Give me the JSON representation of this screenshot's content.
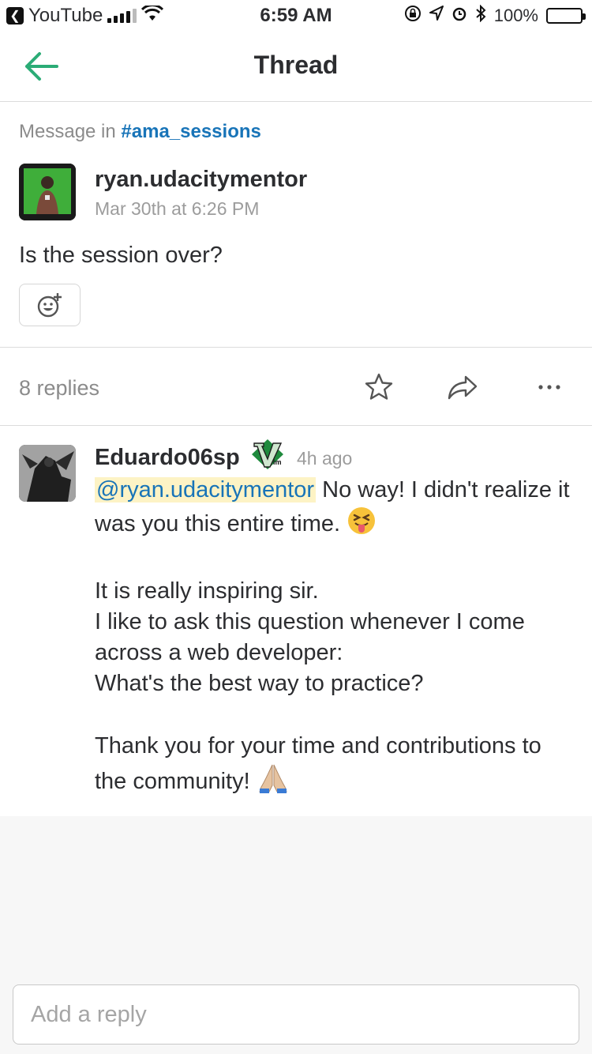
{
  "status_bar": {
    "back_app": "YouTube",
    "time": "6:59 AM",
    "battery": "100%"
  },
  "header": {
    "title": "Thread",
    "back_icon": "arrow-left-icon"
  },
  "parent_message": {
    "context_prefix": "Message in",
    "channel": "#ama_sessions",
    "username": "ryan.udacitymentor",
    "timestamp": "Mar 30th at 6:26 PM",
    "text": "Is the session over?",
    "reaction_icon": "add-reaction-icon"
  },
  "thread_actions": {
    "reply_count": "8 replies",
    "icons": [
      "star-icon",
      "share-icon",
      "more-icon"
    ]
  },
  "reply": {
    "username": "Eduardo06sp",
    "badge_icon": "vim-badge-icon",
    "timestamp": "4h ago",
    "mention": "@ryan.udacitymentor",
    "line1_rest": " No way! I didn't realize it was you this entire time. ",
    "line2": "It is really inspiring sir.",
    "line3": "I like to ask this question whenever I come across a web developer:",
    "line4": "What's the best way to practice?",
    "line5": "Thank you for your time and contributions to the community! ",
    "emoji_1": "tongue-emoji",
    "emoji_2": "praying-hands-emoji"
  },
  "composer": {
    "placeholder": "Add a reply"
  },
  "colors": {
    "accent_green": "#2bac76",
    "link_blue": "#1874b8",
    "mention_bg": "#fdf3c5"
  }
}
